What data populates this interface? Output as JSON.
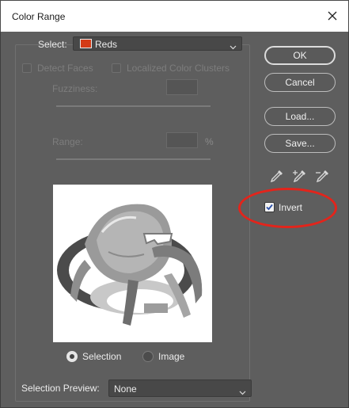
{
  "window": {
    "title": "Color Range"
  },
  "select": {
    "label": "Select:",
    "value": "Reds",
    "swatch_color": "#d43b16"
  },
  "options": {
    "detect_faces": "Detect Faces",
    "localized_clusters": "Localized Color Clusters",
    "fuzziness_label": "Fuzziness:",
    "range_label": "Range:",
    "range_unit": "%"
  },
  "preview_mode": {
    "selection_label": "Selection",
    "image_label": "Image",
    "selected": "selection"
  },
  "selection_preview": {
    "label": "Selection Preview:",
    "value": "None"
  },
  "buttons": {
    "ok": "OK",
    "cancel": "Cancel",
    "load": "Load...",
    "save": "Save..."
  },
  "invert": {
    "label": "Invert",
    "checked": true
  },
  "icons": {
    "close": "close-icon",
    "eyedropper": "eyedropper-icon",
    "eyedropper_add": "eyedropper-plus-icon",
    "eyedropper_subtract": "eyedropper-minus-icon"
  },
  "annotation": {
    "color": "#e3241b"
  }
}
